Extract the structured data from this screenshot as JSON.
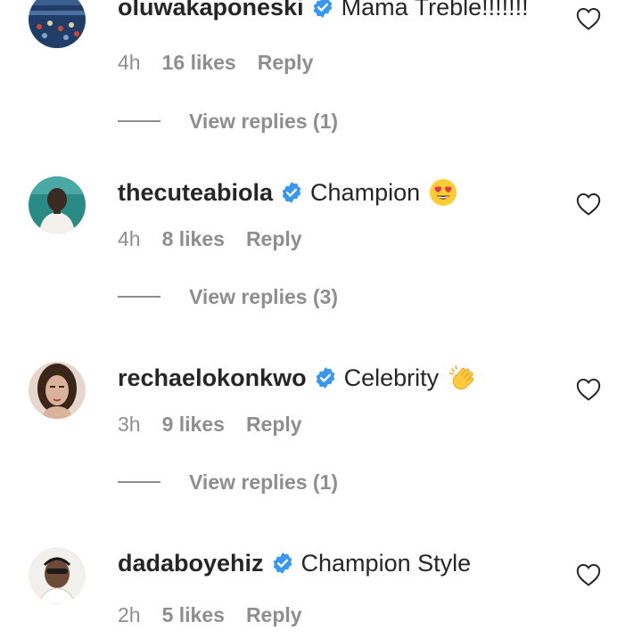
{
  "comments": [
    {
      "username": "oluwakaponeski",
      "text": "Mama Treble!!!!!!!",
      "emoji": "",
      "time": "4h",
      "likes": "16 likes",
      "reply": "Reply",
      "view_replies": "View replies (1)",
      "verified": true,
      "avatar_colors": [
        "#1f3d66",
        "#c64b2f"
      ]
    },
    {
      "username": "thecuteabiola",
      "text": "Champion",
      "emoji": "heart-eyes-emoji",
      "time": "4h",
      "likes": "8 likes",
      "reply": "Reply",
      "view_replies": "View replies (3)",
      "verified": true,
      "avatar_colors": [
        "#2a8a86",
        "#3b2a22"
      ]
    },
    {
      "username": "rechaelokonkwo",
      "text": "Celebrity",
      "emoji": "clapping-hands-emoji",
      "time": "3h",
      "likes": "9 likes",
      "reply": "Reply",
      "view_replies": "View replies (1)",
      "verified": true,
      "avatar_colors": [
        "#d9c3b4",
        "#3a2519"
      ]
    },
    {
      "username": "dadaboyehiz",
      "text": "Champion Style",
      "emoji": "",
      "time": "2h",
      "likes": "5 likes",
      "reply": "Reply",
      "view_replies": "",
      "verified": true,
      "avatar_colors": [
        "#f2f0ec",
        "#6b4a36"
      ]
    }
  ],
  "colors": {
    "text_primary": "#262626",
    "text_secondary": "#8e8e8e",
    "verified_blue": "#3897f0"
  }
}
